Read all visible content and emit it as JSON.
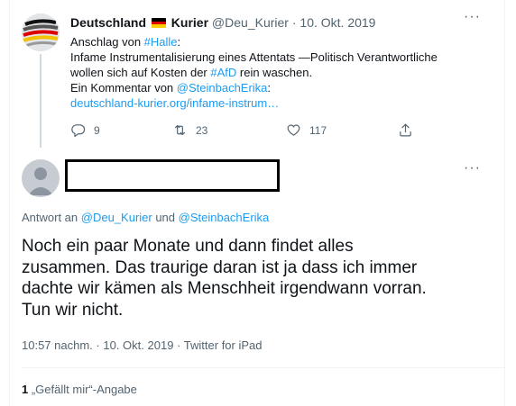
{
  "parent_tweet": {
    "author_name": "Deutschland",
    "author_name_suffix": "Kurier",
    "handle": "@Deu_Kurier",
    "separator": "·",
    "date": "10. Okt. 2019",
    "flag_colors": [
      "#000000",
      "#dd0000",
      "#ffce00"
    ],
    "text": {
      "l1_prefix": "Anschlag von ",
      "l1_hashtag": "#Halle",
      "l1_suffix": ":",
      "l2": "Infame Instrumentalisierung eines Attentats —Politisch Verantwortliche",
      "l3_prefix": "wollen sich auf Kosten der ",
      "l3_hashtag": "#AfD",
      "l3_suffix": " rein waschen.",
      "l4_prefix": "Ein Kommentar von ",
      "l4_mention": "@SteinbachErika",
      "l4_suffix": ":",
      "l5_link": "deutschland-kurier.org/infame-instrum…"
    },
    "actions": {
      "reply_count": "9",
      "retweet_count": "23",
      "like_count": "117"
    },
    "more_icon": "more-horizontal-icon"
  },
  "reply_tweet": {
    "reply_label": "Antwort an ",
    "reply_mention_1": "@Deu_Kurier",
    "reply_and": " und ",
    "reply_mention_2": "@SteinbachErika",
    "text_lines": [
      "Noch ein paar Monate und dann findet alles",
      "zusammen. Das traurige daran ist ja dass ich immer",
      "dachte wir kämen als Menschheit irgendwann vorran.",
      "Tun wir nicht."
    ],
    "time": "10:57 nachm.",
    "separator": "·",
    "date": "10. Okt. 2019",
    "source": "Twitter for iPad",
    "likes_count": "1",
    "likes_label": " „Gefällt mir“-Angabe",
    "more_icon": "more-horizontal-icon"
  },
  "colors": {
    "link": "#1d9bf0",
    "muted": "#536471",
    "text": "#0f1419"
  }
}
